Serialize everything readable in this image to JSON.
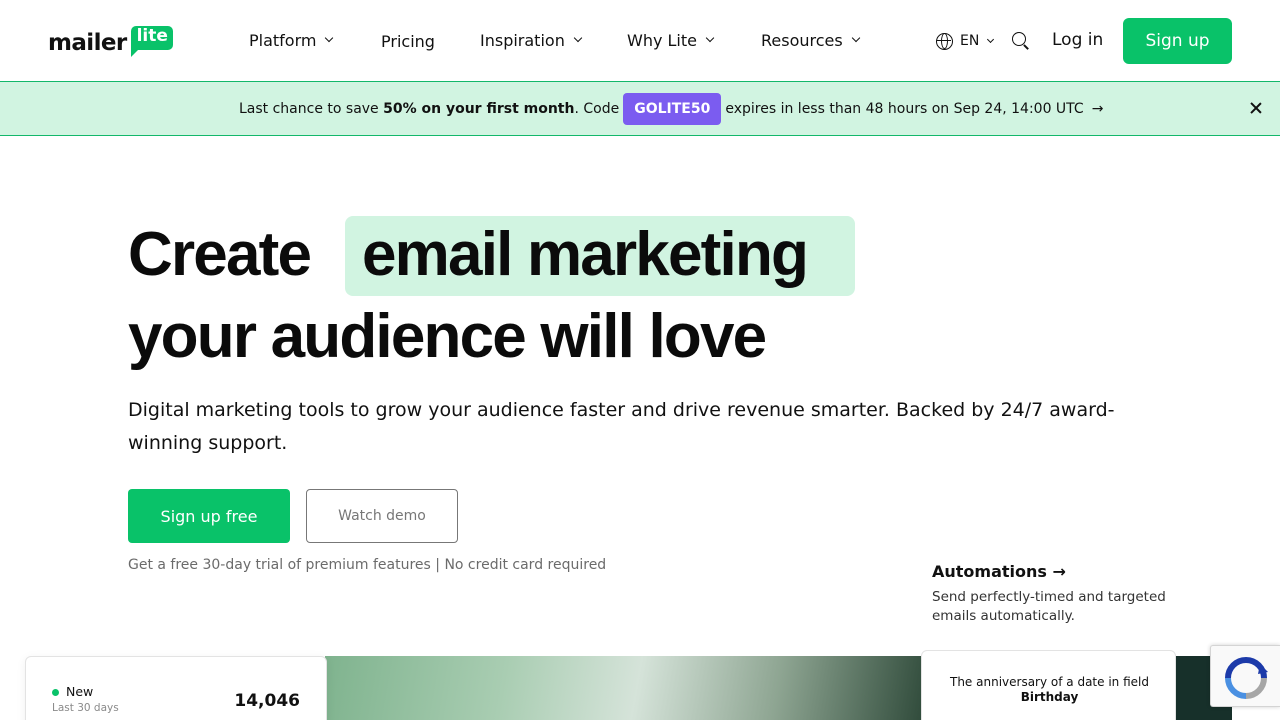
{
  "header": {
    "logo_text": "mailer",
    "logo_badge": "lite",
    "nav": [
      {
        "label": "Platform",
        "has_dropdown": true
      },
      {
        "label": "Pricing",
        "has_dropdown": false
      },
      {
        "label": "Inspiration",
        "has_dropdown": true
      },
      {
        "label": "Why Lite",
        "has_dropdown": true
      },
      {
        "label": "Resources",
        "has_dropdown": true
      }
    ],
    "language": "EN",
    "login_label": "Log in",
    "signup_label": "Sign up"
  },
  "banner": {
    "text_before": "Last chance to save ",
    "bold_text": "50% on your first month",
    "text_code_prefix": ". Code",
    "code": "GOLITE50",
    "text_after": "expires in less than 48 hours on Sep 24, 14:00 UTC",
    "arrow": "→"
  },
  "hero": {
    "title_word_1": "Create",
    "title_highlight": "email marketing",
    "title_line_2": "your audience will love",
    "subtitle": "Digital marketing tools to grow your audience faster and drive revenue smarter. Backed by 24/7 award-winning support.",
    "primary_cta": "Sign up free",
    "secondary_cta": "Watch demo",
    "trial_note": "Get a free 30-day trial of premium features | No credit card required"
  },
  "feature": {
    "title": "Automations →",
    "description": "Send perfectly-timed and targeted emails automatically."
  },
  "stats_card": {
    "label": "New",
    "period": "Last 30 days",
    "value": "14,046"
  },
  "trigger_card": {
    "text_prefix": "The anniversary of a date in field ",
    "field_name": "Birthday"
  },
  "colors": {
    "brand_green": "#09c269",
    "banner_bg": "#d1f4e1",
    "code_purple": "#7b5cf0"
  },
  "icons": [
    "globe-icon",
    "chevron-down-icon",
    "search-icon",
    "close-icon",
    "arrow-right-icon",
    "recaptcha-icon"
  ]
}
